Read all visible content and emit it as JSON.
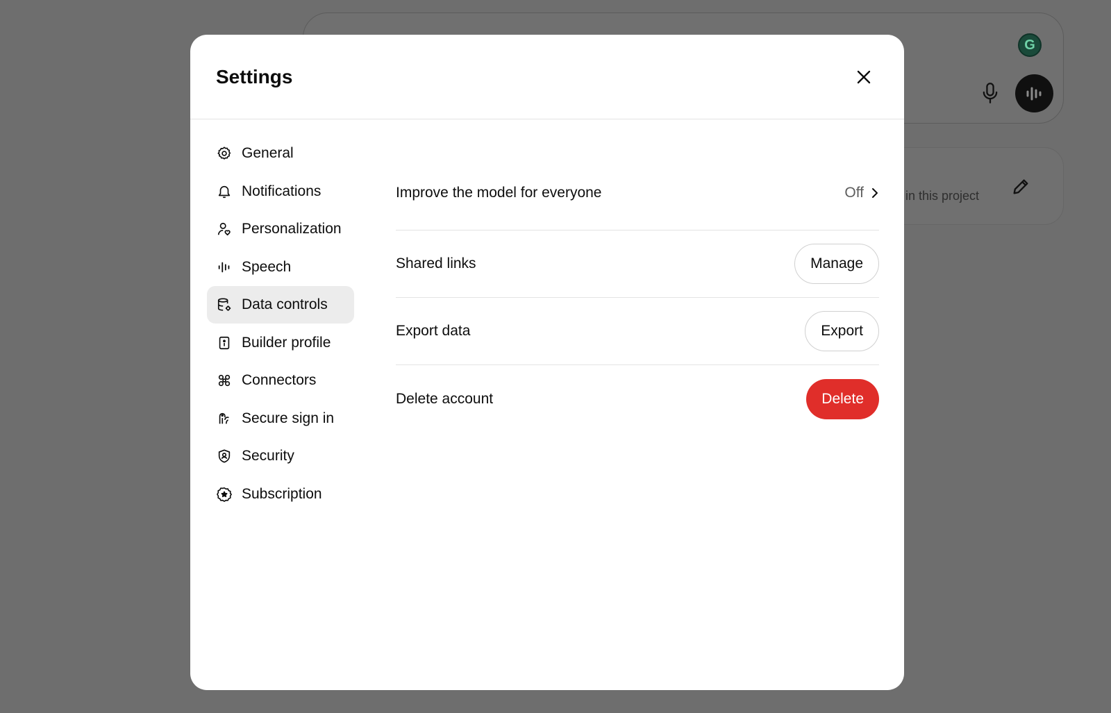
{
  "background": {
    "project_hint": "in this project",
    "grammarly_letter": "G"
  },
  "modal": {
    "title": "Settings"
  },
  "sidebar": {
    "items": [
      {
        "label": "General",
        "icon": "gear-icon"
      },
      {
        "label": "Notifications",
        "icon": "bell-icon"
      },
      {
        "label": "Personalization",
        "icon": "person-heart-icon"
      },
      {
        "label": "Speech",
        "icon": "waveform-icon"
      },
      {
        "label": "Data controls",
        "icon": "database-gear-icon",
        "active": true
      },
      {
        "label": "Builder profile",
        "icon": "id-card-icon"
      },
      {
        "label": "Connectors",
        "icon": "command-icon"
      },
      {
        "label": "Secure sign in",
        "icon": "passkey-icon"
      },
      {
        "label": "Security",
        "icon": "shield-user-icon"
      },
      {
        "label": "Subscription",
        "icon": "badge-star-icon"
      }
    ]
  },
  "content": {
    "improve_model": {
      "label": "Improve the model for everyone",
      "value": "Off"
    },
    "shared_links": {
      "label": "Shared links",
      "button": "Manage"
    },
    "export_data": {
      "label": "Export data",
      "button": "Export"
    },
    "delete_account": {
      "label": "Delete account",
      "button": "Delete"
    }
  },
  "colors": {
    "danger": "#e02e2a",
    "active_nav": "#ececec",
    "overlay": "#6e6e6e"
  }
}
